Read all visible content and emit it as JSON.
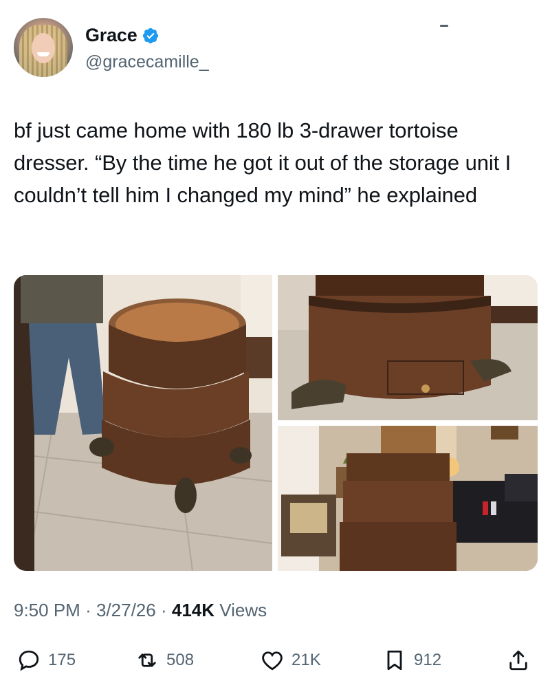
{
  "author": {
    "name": "Grace",
    "handle": "@gracecamille_",
    "verified": true
  },
  "tweet": {
    "text": "bf just came home with 180 lb 3-drawer tortoise dresser. “By the time he got it out of the storage unit I couldn’t tell him I changed my mind” he explained",
    "time": "9:50 PM",
    "date": "3/27/26",
    "views": "414K",
    "views_label": "Views",
    "separator": "·"
  },
  "stats": {
    "replies": "175",
    "reposts": "508",
    "likes": "21K",
    "bookmarks": "912"
  },
  "colors": {
    "text": "#0f1419",
    "secondary": "#536471",
    "verified": "#1d9bf0"
  },
  "icons": [
    "verified-badge-icon",
    "reply-icon",
    "repost-icon",
    "like-icon",
    "bookmark-icon",
    "share-icon"
  ]
}
